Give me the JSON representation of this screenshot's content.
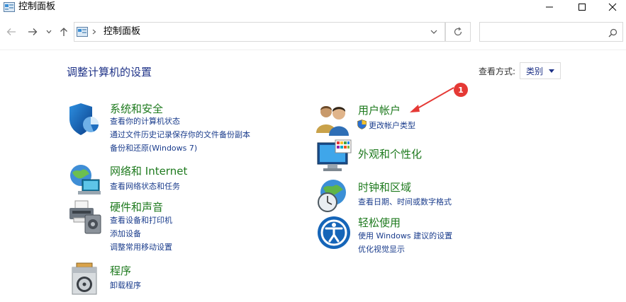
{
  "window": {
    "title": "控制面板"
  },
  "address": {
    "path": "控制面板"
  },
  "search": {
    "placeholder": ""
  },
  "header": {
    "title": "调整计算机的设置",
    "view_label": "查看方式:",
    "view_value": "类别"
  },
  "categories": [
    {
      "title": "系统和安全",
      "icon": "shield-icon",
      "links": [
        "查看你的计算机状态",
        "通过文件历史记录保存你的文件备份副本",
        "备份和还原(Windows 7)"
      ]
    },
    {
      "title": "网络和 Internet",
      "icon": "network-globe-icon",
      "links": [
        "查看网络状态和任务"
      ]
    },
    {
      "title": "硬件和声音",
      "icon": "printer-icon",
      "links": [
        "查看设备和打印机",
        "添加设备",
        "调整常用移动设置"
      ]
    },
    {
      "title": "程序",
      "icon": "programs-disc-icon",
      "links": [
        "卸载程序"
      ]
    },
    {
      "title": "用户帐户",
      "icon": "users-icon",
      "links": [
        "更改帐户类型"
      ]
    },
    {
      "title": "外观和个性化",
      "icon": "monitor-palette-icon",
      "links": []
    },
    {
      "title": "时钟和区域",
      "icon": "clock-globe-icon",
      "links": [
        "查看日期、时间或数字格式"
      ]
    },
    {
      "title": "轻松使用",
      "icon": "ease-of-access-icon",
      "links": [
        "使用 Windows 建议的设置",
        "优化视觉显示"
      ]
    }
  ],
  "annotation": {
    "badge": "1"
  },
  "colors": {
    "heading": "#1e3287",
    "category_title": "#1e7a1e",
    "link": "#1a3c8c",
    "badge": "#e53935"
  }
}
